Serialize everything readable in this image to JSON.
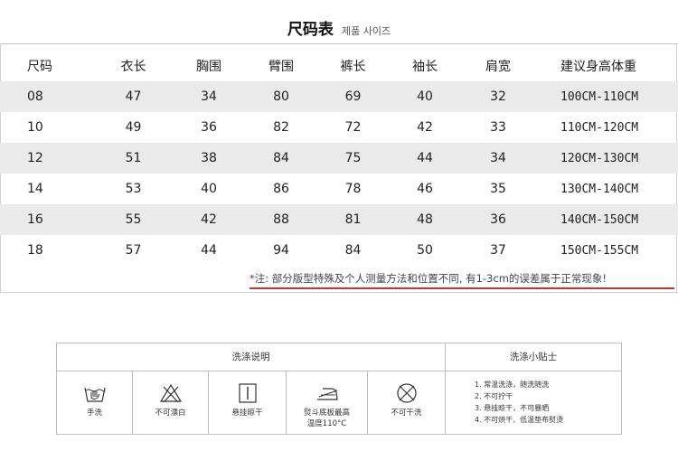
{
  "title": {
    "main": "尺码表",
    "sub": "제품 사이즈"
  },
  "table": {
    "headers": [
      "尺码",
      "衣长",
      "胸围",
      "臂围",
      "裤长",
      "袖长",
      "肩宽",
      "建议身高体重"
    ],
    "rows": [
      [
        "08",
        "47",
        "34",
        "80",
        "69",
        "40",
        "32",
        "100CM-110CM"
      ],
      [
        "10",
        "49",
        "36",
        "82",
        "72",
        "42",
        "33",
        "110CM-120CM"
      ],
      [
        "12",
        "51",
        "38",
        "84",
        "75",
        "44",
        "34",
        "120CM-130CM"
      ],
      [
        "14",
        "53",
        "40",
        "86",
        "78",
        "46",
        "35",
        "130CM-140CM"
      ],
      [
        "16",
        "55",
        "42",
        "88",
        "81",
        "48",
        "36",
        "140CM-150CM"
      ],
      [
        "18",
        "57",
        "44",
        "94",
        "84",
        "50",
        "37",
        "150CM-155CM"
      ]
    ]
  },
  "note": "*注: 部分版型特殊及个人测量方法和位置不同, 有1-3cm的误差属于正常现象!",
  "colors": {
    "accent_line": "#c0392b",
    "row_shade": "#eaeaea"
  },
  "care": {
    "instructions_header": "洗涤说明",
    "tips_header": "洗涤小贴士",
    "icons": [
      {
        "icon": "hand-wash-icon",
        "label": "手洗"
      },
      {
        "icon": "no-bleach-icon",
        "label": "不可漂白"
      },
      {
        "icon": "hang-dry-icon",
        "label": "悬挂晾干"
      },
      {
        "icon": "iron-icon",
        "label": "熨斗底板最高",
        "label2": "温度110°C"
      },
      {
        "icon": "no-dry-clean-icon",
        "label": "不可干洗"
      }
    ],
    "tips": [
      "1. 常温洗涤，随洗随洗",
      "2. 不可拧干",
      "3. 悬挂晾干，不可暴晒",
      "4. 不可烘干、低温垫布熨烫"
    ]
  }
}
